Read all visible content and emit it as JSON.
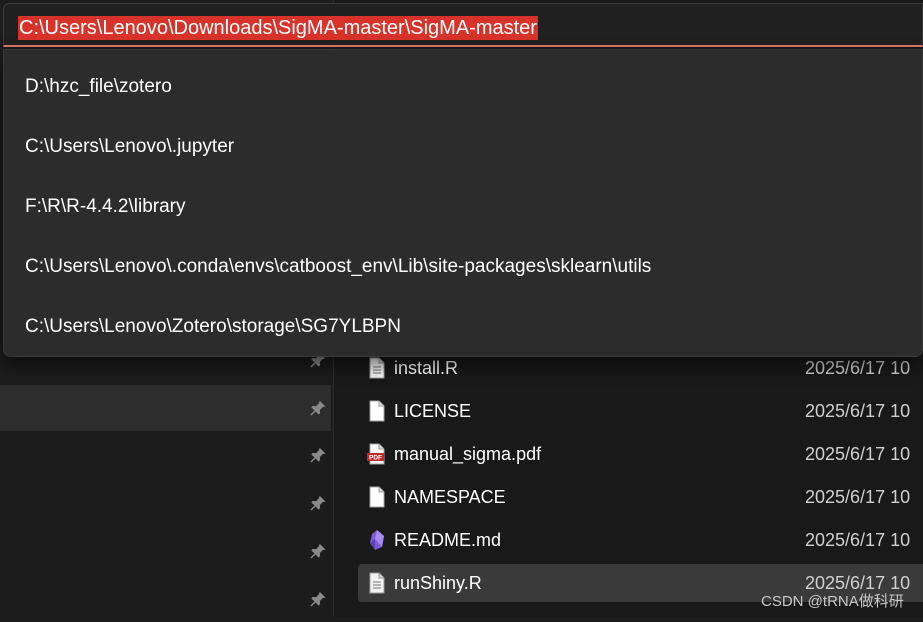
{
  "address_bar": {
    "path": "C:\\Users\\Lenovo\\Downloads\\SigMA-master\\SigMA-master"
  },
  "dropdown": {
    "items": [
      "D:\\hzc_file\\zotero",
      "C:\\Users\\Lenovo\\.jupyter",
      "F:\\R\\R-4.4.2\\library",
      "C:\\Users\\Lenovo\\.conda\\envs\\catboost_env\\Lib\\site-packages\\sklearn\\utils",
      "C:\\Users\\Lenovo\\Zotero\\storage\\SG7YLBPN"
    ]
  },
  "files": [
    {
      "name": "install.R",
      "date": "2025/6/17 10",
      "icon": "document-icon"
    },
    {
      "name": "LICENSE",
      "date": "2025/6/17 10",
      "icon": "blank-file-icon"
    },
    {
      "name": "manual_sigma.pdf",
      "date": "2025/6/17 10",
      "icon": "pdf-icon"
    },
    {
      "name": "NAMESPACE",
      "date": "2025/6/17 10",
      "icon": "blank-file-icon"
    },
    {
      "name": "README.md",
      "date": "2025/6/17 10",
      "icon": "obsidian-icon"
    },
    {
      "name": "runShiny.R",
      "date": "2025/6/17 10",
      "icon": "document-icon"
    }
  ],
  "watermark": "CSDN @tRNA做科研",
  "colors": {
    "highlight": "#d8332a",
    "focus_underline": "#e2786a",
    "pdf_red": "#c62828",
    "obsidian_purple": "#7c5cd6"
  }
}
